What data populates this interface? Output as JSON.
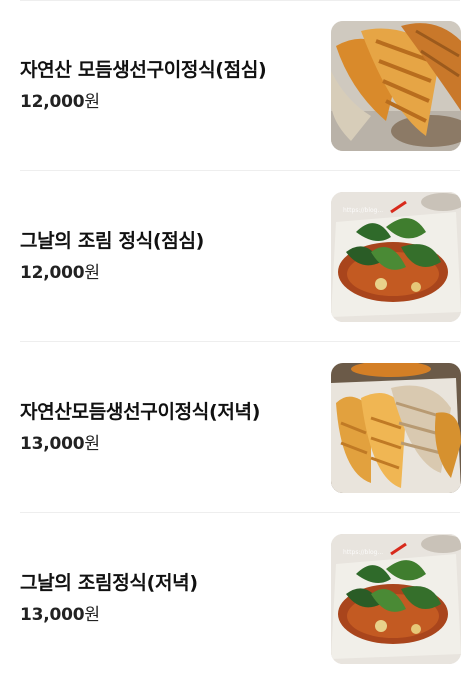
{
  "menu": {
    "items": [
      {
        "name": "자연산 모듬생선구이정식(점심)",
        "price": "12,000",
        "currency": "원",
        "photo_icon": "grilled-fish-photo"
      },
      {
        "name": "그날의 조림 정식(점심)",
        "price": "12,000",
        "currency": "원",
        "photo_icon": "braised-fish-photo"
      },
      {
        "name": "자연산모듬생선구이정식(저녁)",
        "price": "13,000",
        "currency": "원",
        "photo_icon": "grilled-fish-photo"
      },
      {
        "name": "그날의 조림정식(저녁)",
        "price": "13,000",
        "currency": "원",
        "photo_icon": "braised-fish-photo"
      }
    ]
  }
}
